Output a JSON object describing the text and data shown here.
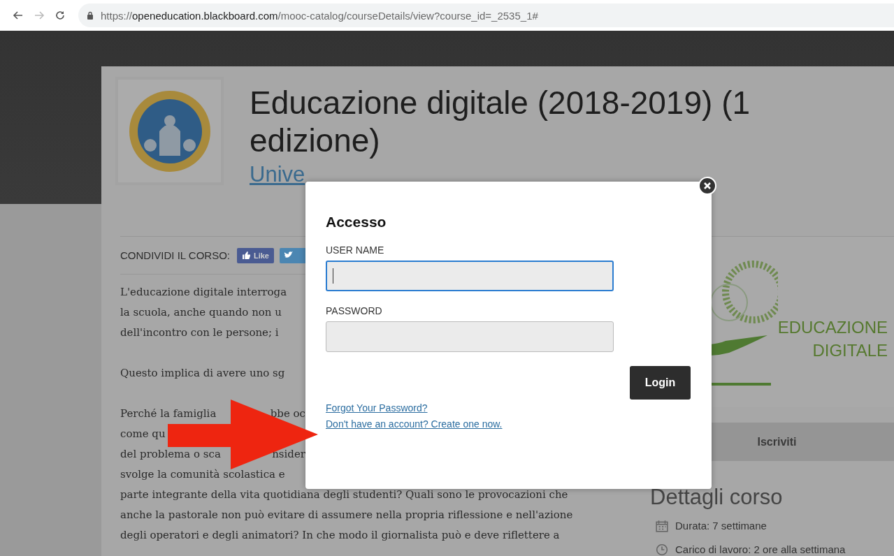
{
  "browser": {
    "url": {
      "scheme": "https://",
      "host": "openeducation.blackboard.com",
      "path": "/mooc-catalog/courseDetails/view?course_id=_2535_1#"
    }
  },
  "course": {
    "title": "Educazione digitale (2018-2019) (1 edizione)",
    "university_link": "Unive"
  },
  "share": {
    "label": "CONDIVIDI IL CORSO:",
    "like_button": "Like"
  },
  "description": {
    "paragraphs": [
      {
        "lines": [
          [
            "L'educazione digitale interroga"
          ],
          [
            "la scuola, anche quando non u"
          ],
          [
            "dell'incontro con le persone; i"
          ]
        ]
      },
      {
        "lines": [
          [
            "Questo implica di avere uno sg"
          ]
        ]
      },
      {
        "lines": [
          [
            "Perché la famiglia",
            "bbe oc"
          ],
          [
            "come qu"
          ],
          [
            "del problema o sca",
            "nsider"
          ],
          [
            "svolge la comunità scolastica e"
          ],
          [
            "parte integrante della vita quotidiana degli studenti? Quali sono le provocazioni che"
          ],
          [
            "anche la pastorale non può evitare di assumere nella propria riflessione e nell'azione"
          ],
          [
            "degli operatori e degli animatori? In che modo il giornalista può e deve riflettere a"
          ]
        ]
      }
    ]
  },
  "sidebar": {
    "logo_text": [
      "EDUCAZIONE",
      "DIGITALE"
    ],
    "enroll_button": "Iscriviti",
    "details_title": "Dettagli corso",
    "details": [
      {
        "kind": "duration",
        "text": "Durata: 7 settimane"
      },
      {
        "kind": "workload",
        "text": "Carico di lavoro: 2 ore alla settimana"
      }
    ]
  },
  "login_dialog": {
    "title": "Accesso",
    "fields": [
      {
        "label": "USER NAME",
        "focused": true
      },
      {
        "label": "PASSWORD",
        "focused": false
      }
    ],
    "login_button": "Login",
    "links": [
      "Forgot Your Password?",
      "Don't have an account? Create one now."
    ]
  }
}
